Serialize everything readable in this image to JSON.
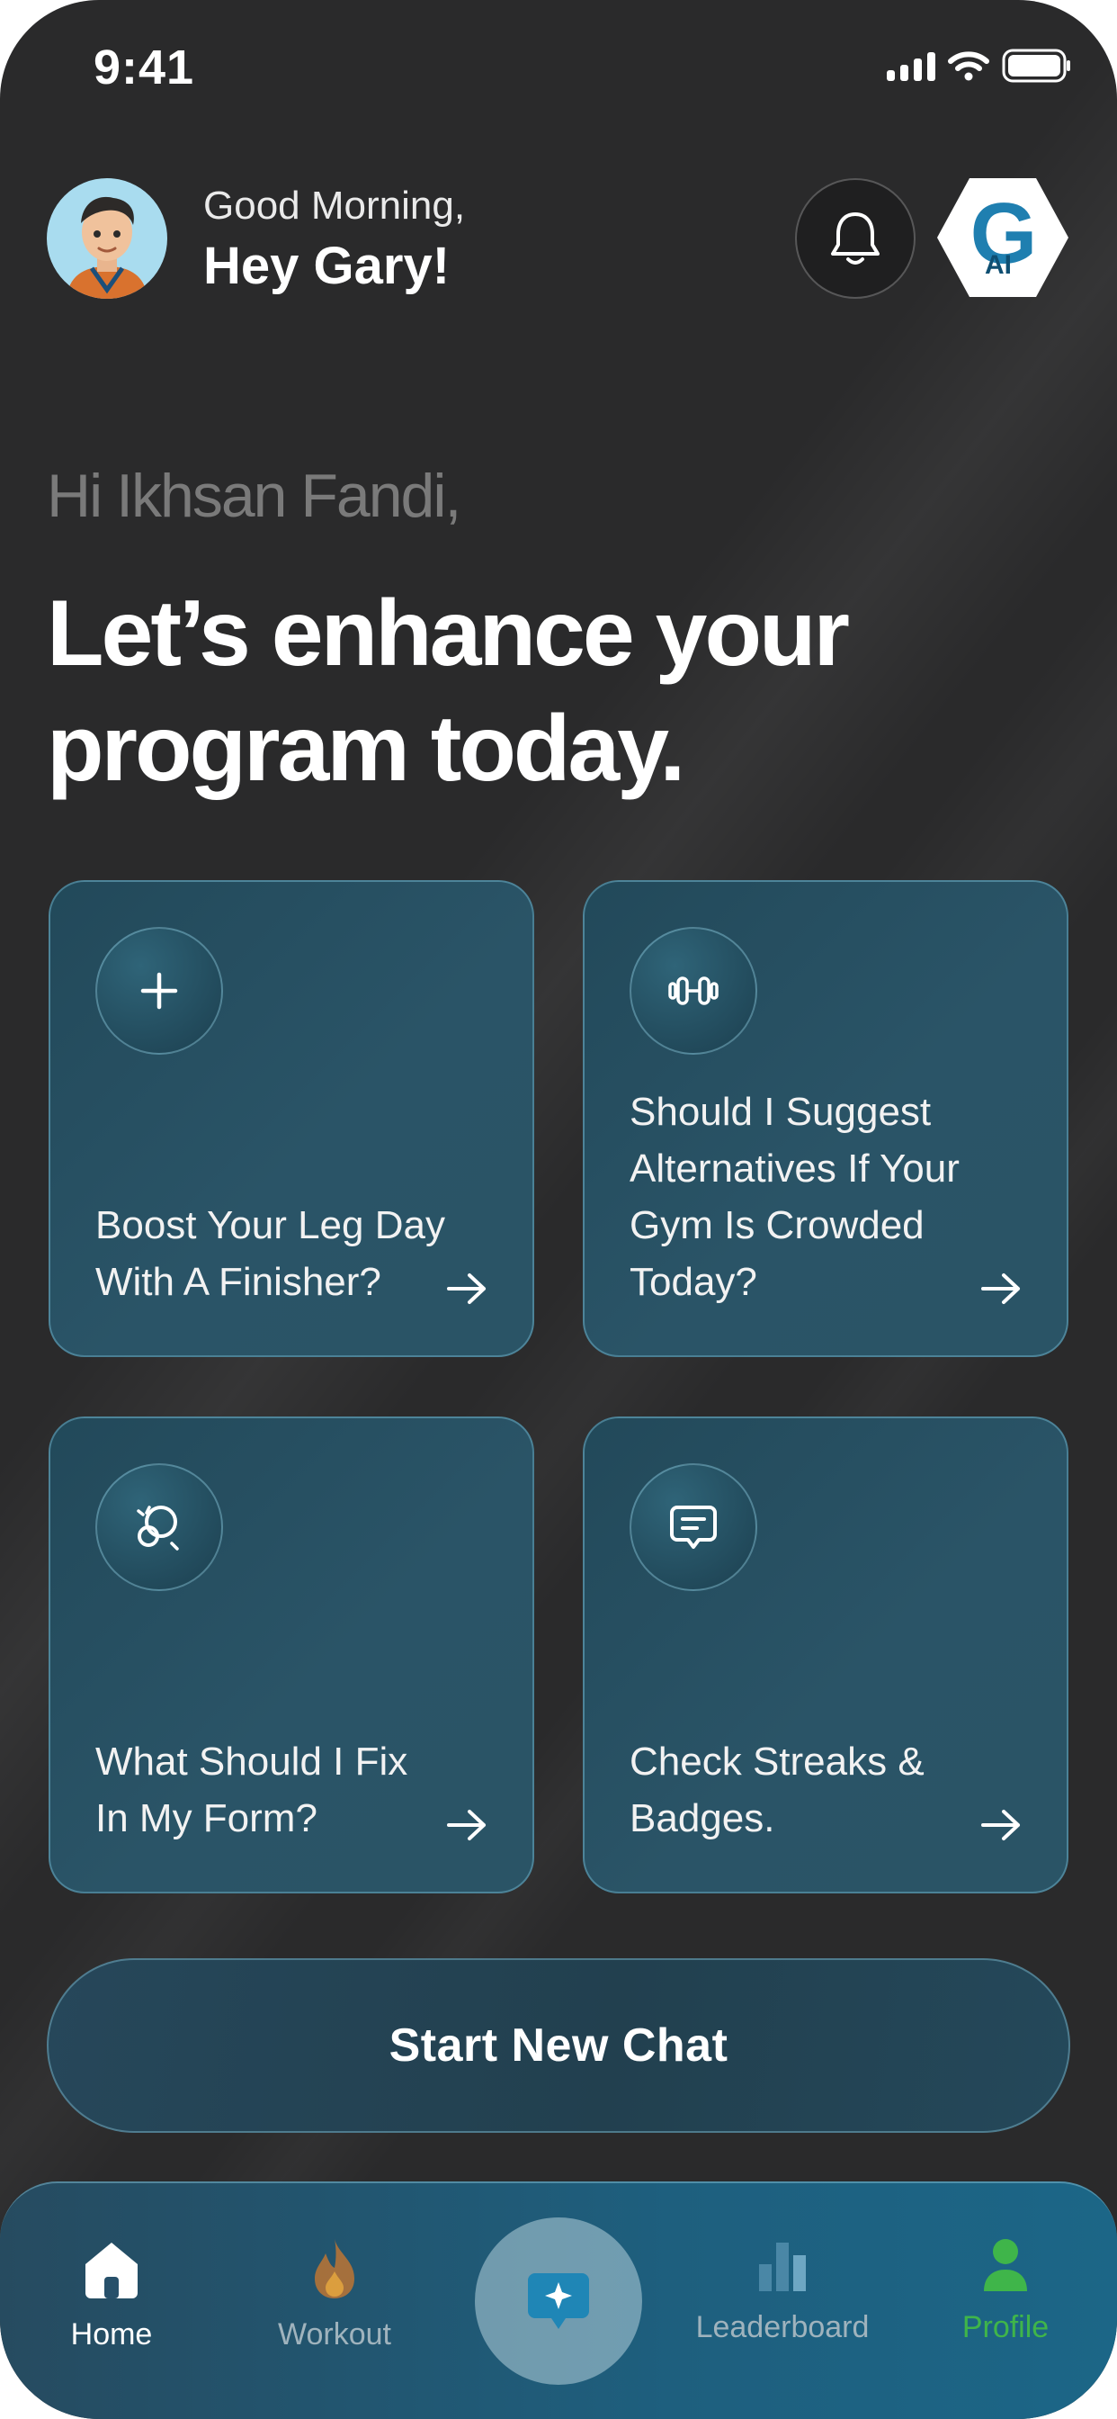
{
  "status_bar": {
    "time": "9:41"
  },
  "header": {
    "greeting": "Good Morning,",
    "name_line": "Hey Gary!",
    "logo_text": "G",
    "logo_sub": "AI"
  },
  "hero": {
    "hi": "Hi Ikhsan Fandi,",
    "headline": "Let’s enhance your program today."
  },
  "cards": [
    {
      "icon": "plus-icon",
      "text": "Boost Your Leg Day With A Finisher?"
    },
    {
      "icon": "dumbbell-icon",
      "text": "Should I Suggest Alternatives If Your Gym Is Crowded Today?"
    },
    {
      "icon": "form-check-icon",
      "text": "What Should I Fix In My Form?"
    },
    {
      "icon": "chat-icon",
      "text": "Check Streaks & Badges."
    }
  ],
  "start_chat_label": "Start New Chat",
  "nav": {
    "items": [
      {
        "label": "Home",
        "icon": "home-icon",
        "color": "#ffffff"
      },
      {
        "label": "Workout",
        "icon": "flame-icon",
        "color": "#9fb3bd"
      },
      {
        "label": "Leaderboard",
        "icon": "bar-chart-icon",
        "color": "#9fb3bd"
      },
      {
        "label": "Profile",
        "icon": "user-icon",
        "color": "#3fb54a"
      }
    ],
    "center_icon": "sparkle-chat-icon"
  },
  "colors": {
    "background": "#2a2a2b",
    "card": "#2a5467",
    "accent_green": "#3fb54a",
    "accent_blue": "#1f7fb0"
  }
}
